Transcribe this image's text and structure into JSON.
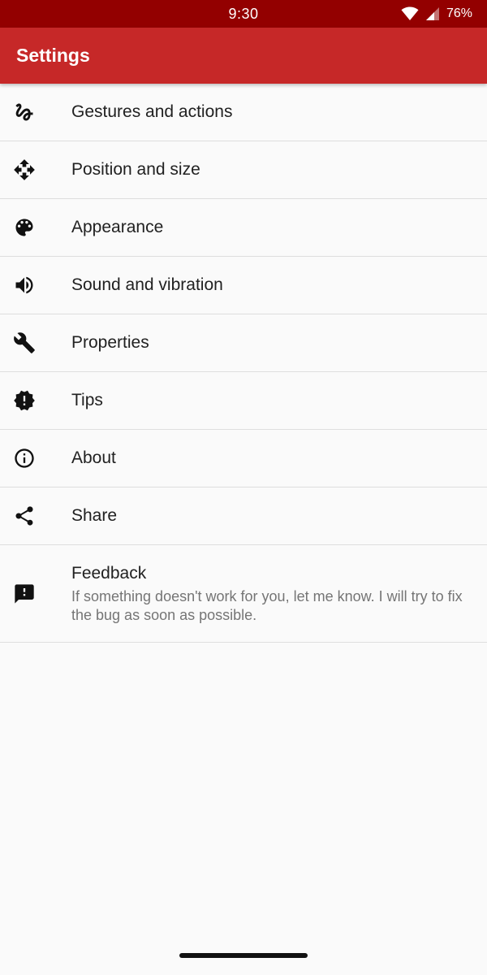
{
  "status_bar": {
    "time": "9:30",
    "battery": "76%",
    "icons": [
      "wifi-icon",
      "cell-signal-icon"
    ],
    "color": "#930000"
  },
  "app_bar": {
    "title": "Settings",
    "color": "#c62828"
  },
  "items": [
    {
      "label": "Gestures and actions",
      "icon": "gesture-icon"
    },
    {
      "label": "Position and size",
      "icon": "move-arrows-icon"
    },
    {
      "label": "Appearance",
      "icon": "palette-icon"
    },
    {
      "label": "Sound and vibration",
      "icon": "volume-icon"
    },
    {
      "label": "Properties",
      "icon": "wrench-icon"
    },
    {
      "label": "Tips",
      "icon": "alert-badge-icon"
    },
    {
      "label": "About",
      "icon": "info-icon"
    },
    {
      "label": "Share",
      "icon": "share-icon"
    },
    {
      "label": "Feedback",
      "summary": "If something doesn't work for you, let me know. I will try to fix the bug as soon as possible.",
      "icon": "feedback-icon"
    }
  ]
}
